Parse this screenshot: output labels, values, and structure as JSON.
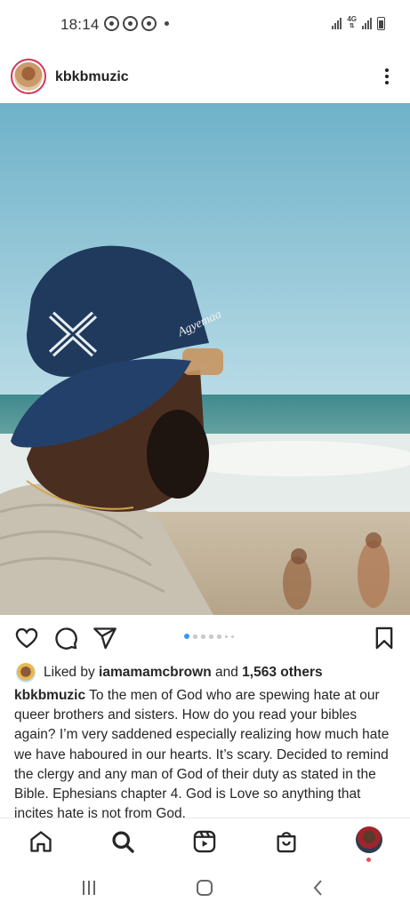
{
  "status_bar": {
    "time": "18:14",
    "notification_icons": [
      "whatsapp-icon",
      "whatsapp-icon",
      "whatsapp-icon",
      "dot-icon"
    ],
    "network": "4G"
  },
  "post": {
    "username": "kbkbmuzic",
    "image_alt_icon": "photo-image",
    "carousel": {
      "total": 7,
      "active_index": 0
    },
    "cap_text": "Agyemaa",
    "likes": {
      "prefix": "Liked by ",
      "user": "iamamamcbrown",
      "middle": " and ",
      "count": "1,563 others"
    },
    "caption": {
      "author": "kbkbmuzic",
      "text": " To the men of God who are spewing hate at our queer brothers and sisters. How do you read your bibles again? I’m very saddened especially realizing how much hate we have haboured in our hearts. It’s scary. Decided to remind the clergy and any man of God of their duty as stated in the Bible. Ephesians chapter 4. God is Love so anything that incites hate is not from God."
    }
  },
  "bottom_nav": [
    "home-icon",
    "search-icon",
    "reels-icon",
    "shop-icon",
    "profile-avatar"
  ],
  "android_nav": [
    "recents-icon",
    "home-circle-icon",
    "back-icon"
  ],
  "colors": {
    "accent_blue": "#3897f0",
    "notification_red": "#ed4956",
    "story_ring": "#d1355b",
    "text": "#262626"
  }
}
